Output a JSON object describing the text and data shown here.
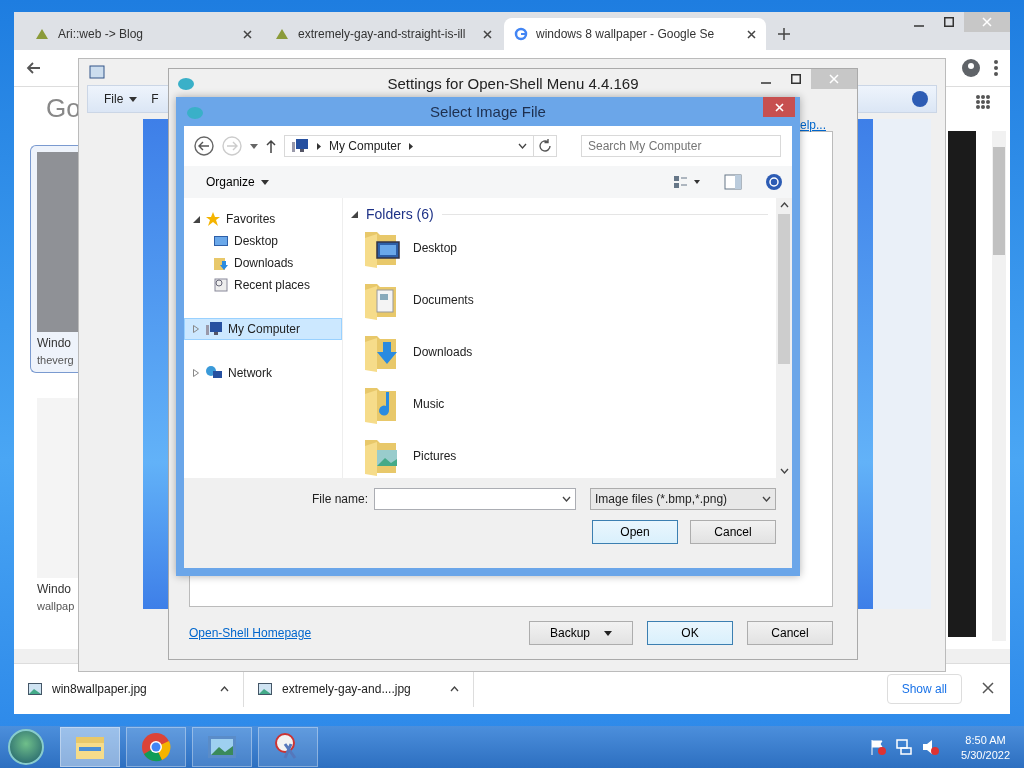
{
  "browser": {
    "tabs": [
      {
        "title": "Ari::web -> Blog",
        "selected": false
      },
      {
        "title": "extremely-gay-and-straight-is-ill",
        "selected": false
      },
      {
        "title": "windows 8 wallpaper - Google Se",
        "selected": true
      }
    ],
    "logo": "Go",
    "results": [
      {
        "title": "Windo",
        "source": "theverg",
        "selected": true
      },
      {
        "title": "Windo",
        "source": "wallpap",
        "selected": false
      }
    ],
    "downloads": [
      {
        "name": "win8wallpaper.jpg"
      },
      {
        "name": "extremely-gay-and....jpg"
      }
    ],
    "show_all": "Show all"
  },
  "back_window": {
    "menu": [
      "File",
      "F"
    ],
    "help_link": "elp..."
  },
  "settings": {
    "title": "Settings for Open-Shell Menu 4.4.169",
    "homepage_link": "Open-Shell Homepage",
    "buttons": [
      {
        "label": "Backup",
        "kind": "split"
      },
      {
        "label": "OK",
        "kind": "default"
      },
      {
        "label": "Cancel",
        "kind": "plain"
      }
    ]
  },
  "dialog": {
    "title": "Select Image File",
    "path": "My Computer",
    "search_placeholder": "Search My Computer",
    "organize": "Organize",
    "nav": [
      {
        "label": "Favorites",
        "kind": "star",
        "selected": false,
        "expanded": true,
        "children": [
          {
            "label": "Desktop",
            "kind": "desktop",
            "selected": false
          },
          {
            "label": "Downloads",
            "kind": "downloads",
            "selected": false
          },
          {
            "label": "Recent places",
            "kind": "recent",
            "selected": false
          }
        ]
      },
      {
        "label": "My Computer",
        "kind": "computer",
        "selected": true,
        "expanded": false
      },
      {
        "label": "Network",
        "kind": "network",
        "selected": false,
        "expanded": false
      }
    ],
    "group": "Folders (6)",
    "folders": [
      {
        "name": "Desktop",
        "kind": "desktop"
      },
      {
        "name": "Documents",
        "kind": "documents"
      },
      {
        "name": "Downloads",
        "kind": "downloads"
      },
      {
        "name": "Music",
        "kind": "music"
      },
      {
        "name": "Pictures",
        "kind": "pictures"
      }
    ],
    "file_name_label": "File name:",
    "filter": "Image files (*.bmp,*.png)",
    "buttons": [
      {
        "label": "Open",
        "kind": "default"
      },
      {
        "label": "Cancel",
        "kind": "plain"
      }
    ]
  },
  "taskbar": {
    "apps": [
      {
        "kind": "explorer",
        "selected": true
      },
      {
        "kind": "chrome",
        "selected": false
      },
      {
        "kind": "photos",
        "selected": false
      },
      {
        "kind": "snip",
        "selected": false
      }
    ],
    "time": "8:50 AM",
    "date": "5/30/2022"
  }
}
